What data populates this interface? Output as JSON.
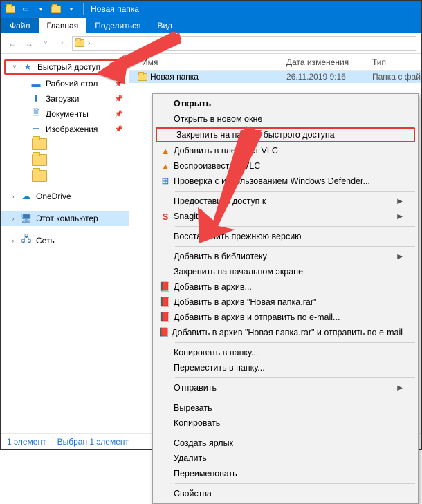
{
  "window": {
    "title": "Новая папка"
  },
  "ribbon": {
    "file": "Файл",
    "home": "Главная",
    "share": "Поделиться",
    "view": "Вид"
  },
  "tree": {
    "quick_access": "Быстрый доступ",
    "desktop": "Рабочий стол",
    "downloads": "Загрузки",
    "documents": "Документы",
    "pictures": "Изображения",
    "onedrive": "OneDrive",
    "this_pc": "Этот компьютер",
    "network": "Сеть"
  },
  "columns": {
    "name": "Имя",
    "date": "Дата изменения",
    "type": "Тип"
  },
  "file": {
    "name": "Новая папка",
    "date": "26.11.2019 9:16",
    "type": "Папка с фай"
  },
  "statusbar": {
    "count": "1 элемент",
    "selection": "Выбран 1 элемент"
  },
  "ctx": {
    "open": "Открыть",
    "open_new": "Открыть в новом окне",
    "pin_qa": "Закрепить на панели быстрого доступа",
    "vlc_add": "Добавить в плейлист VLC",
    "vlc_play": "Воспроизвести в VLC",
    "defender": "Проверка с использованием Windows Defender...",
    "share_access": "Предоставить доступ к",
    "snagit": "Snagit",
    "restore": "Восстановить прежнюю версию",
    "add_lib": "Добавить в библиотеку",
    "pin_start": "Закрепить на начальном экране",
    "rar_add": "Добавить в архив...",
    "rar_add_named": "Добавить в архив \"Новая папка.rar\"",
    "rar_email": "Добавить в архив и отправить по e-mail...",
    "rar_email_named": "Добавить в архив \"Новая папка.rar\" и отправить по e-mail",
    "copy_to": "Копировать в папку...",
    "move_to": "Переместить в папку...",
    "send_to": "Отправить",
    "cut": "Вырезать",
    "copy": "Копировать",
    "shortcut": "Создать ярлык",
    "delete": "Удалить",
    "rename": "Переименовать",
    "properties": "Свойства"
  }
}
